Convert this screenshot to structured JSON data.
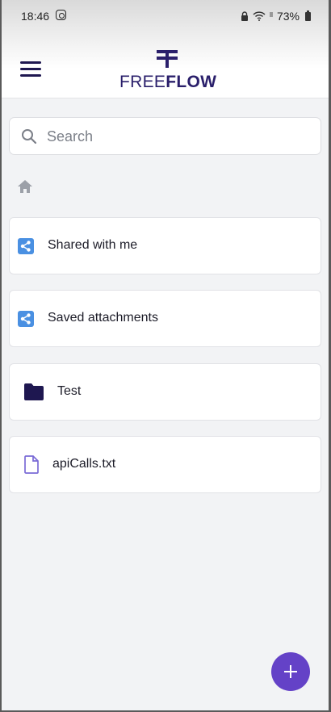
{
  "status_bar": {
    "time": "18:46",
    "battery": "73%",
    "signal_glyph": "ᴵᴵ",
    "icons": [
      "instagram-icon",
      "lock-icon",
      "wifi-icon",
      "signal-icon",
      "battery-icon"
    ]
  },
  "header": {
    "logo_light": "FREE",
    "logo_bold": "FLOW",
    "menu_icon": "hamburger-menu-icon"
  },
  "search": {
    "placeholder": "Search",
    "value": ""
  },
  "breadcrumb": {
    "home_icon": "home-icon"
  },
  "items": [
    {
      "label": "Shared with me",
      "icon": "share-icon"
    },
    {
      "label": "Saved attachments",
      "icon": "share-icon"
    },
    {
      "label": "Test",
      "icon": "folder-icon"
    },
    {
      "label": "apiCalls.txt",
      "icon": "file-icon"
    }
  ],
  "fab": {
    "icon": "plus-icon"
  },
  "colors": {
    "brand": "#2a1f6b",
    "accent": "#6442c7",
    "share_icon": "#4a90e2",
    "folder_icon": "#1e1750",
    "file_icon": "#7a6bd6",
    "background": "#f2f3f5"
  }
}
